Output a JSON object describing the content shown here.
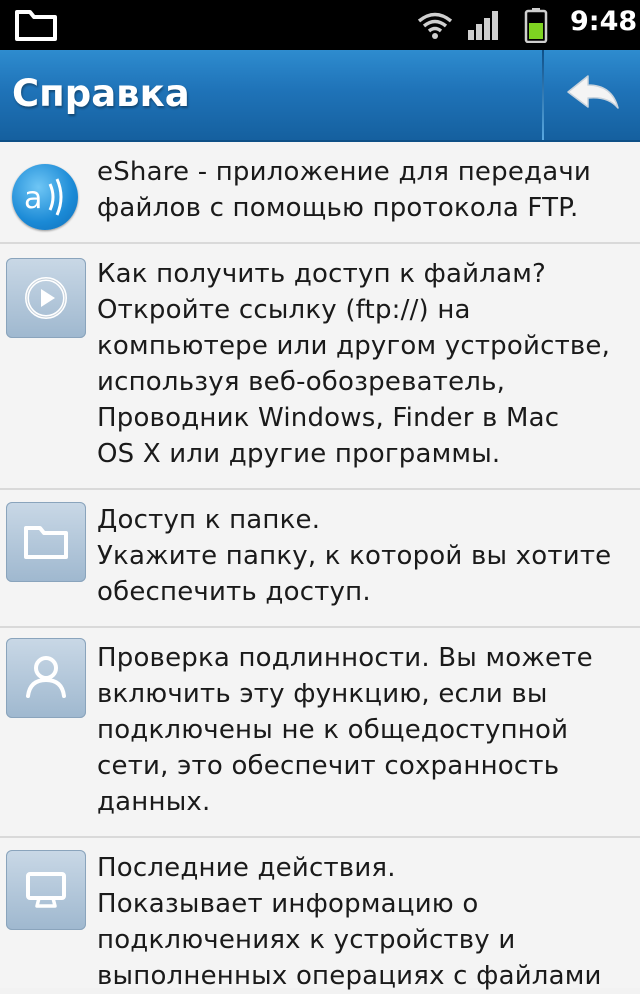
{
  "status_bar": {
    "time": "9:48",
    "icons": [
      "folder-icon",
      "wifi-icon",
      "signal-icon",
      "battery-icon"
    ],
    "battery_color": "#7ed321"
  },
  "title_bar": {
    "title": "Справка",
    "back_icon": "back-arrow-icon",
    "background": "#1f73b8"
  },
  "help_items": [
    {
      "icon": "eshare-logo-icon",
      "text": "eShare - приложение для передачи\nфайлов с помощью протокола FTP."
    },
    {
      "icon": "play-icon",
      "text": "Как получить доступ к файлам?\nОткройте ссылку (ftp://) на\nкомпьютере или другом устройстве,\nиспользуя веб-обозреватель,\nПроводник Windows, Finder в Mac\nOS X или другие программы."
    },
    {
      "icon": "folder-icon",
      "text": "Доступ к папке.\nУкажите папку, к которой вы хотите\nобеспечить доступ."
    },
    {
      "icon": "user-icon",
      "text": "Проверка подлинности. Вы можете\nвключить эту функцию, если вы\nподключены не к общедоступной\nсети, это обеспечит сохранность\nданных."
    },
    {
      "icon": "computer-icon",
      "text": "Последние действия.\nПоказывает информацию о\nподключениях к устройству и\nвыполненных операциях с файлами"
    }
  ]
}
